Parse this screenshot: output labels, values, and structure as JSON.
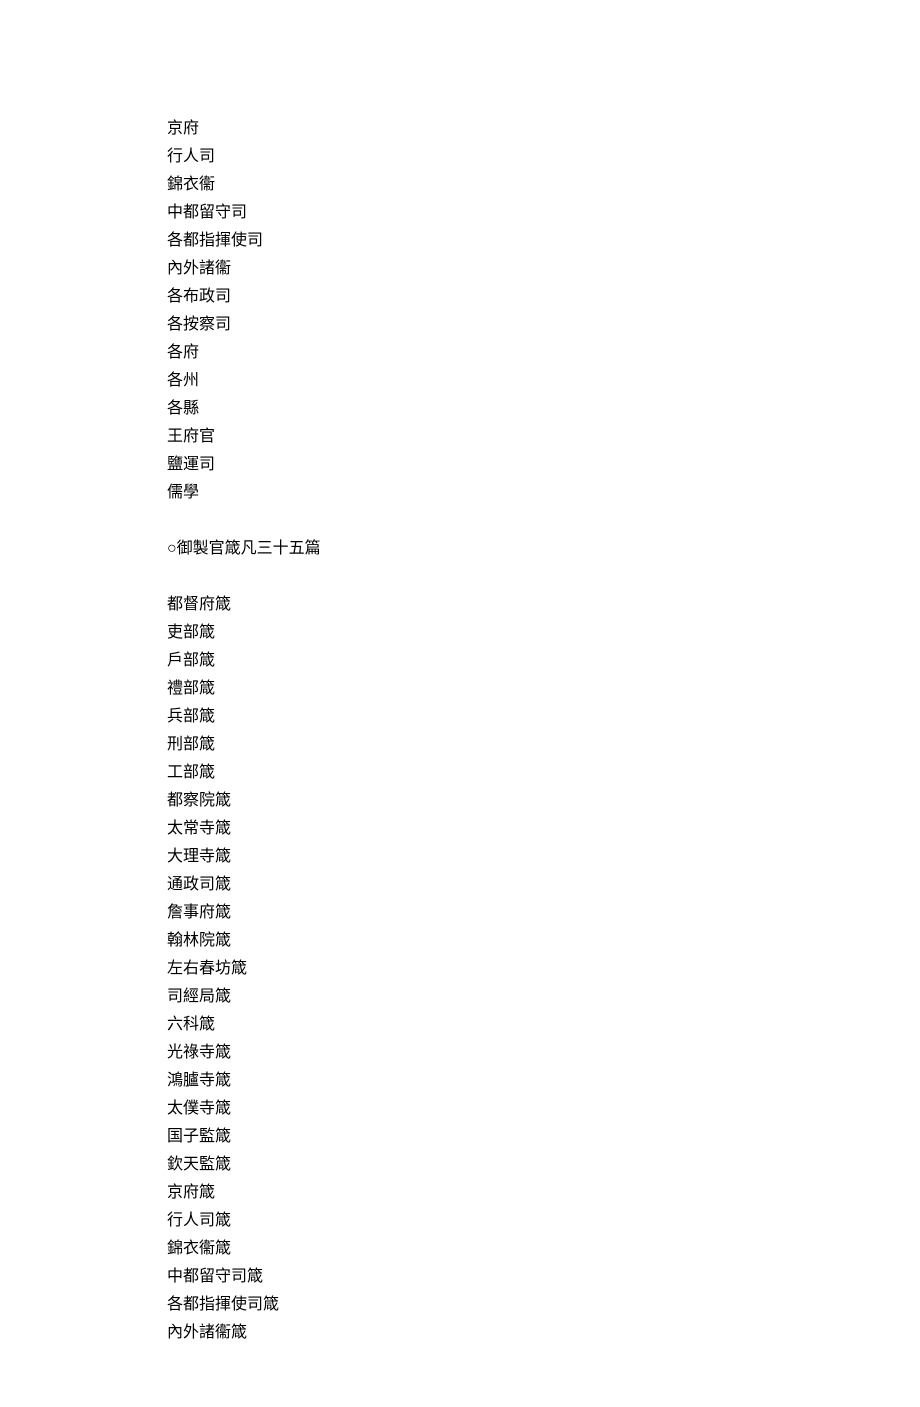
{
  "section1": {
    "lines": [
      "京府",
      "行人司",
      "錦衣衞",
      "中都留守司",
      "各都指揮使司",
      "內外諸衞",
      "各布政司",
      "各按察司",
      "各府",
      "各州",
      "各縣",
      "王府官",
      "鹽運司",
      "儒學"
    ]
  },
  "heading": "○御製官箴凡三十五篇",
  "section2": {
    "lines": [
      "都督府箴",
      "吏部箴",
      "戶部箴",
      "禮部箴",
      "兵部箴",
      "刑部箴",
      "工部箴",
      "都察院箴",
      "太常寺箴",
      "大理寺箴",
      "通政司箴",
      "詹事府箴",
      "翰林院箴",
      "左右春坊箴",
      "司經局箴",
      "六科箴",
      "光祿寺箴",
      "鴻臚寺箴",
      "太僕寺箴",
      "国子監箴",
      "欽天監箴",
      "京府箴",
      "行人司箴",
      "錦衣衞箴",
      "中都留守司箴",
      "各都指揮使司箴",
      "內外諸衞箴"
    ]
  }
}
